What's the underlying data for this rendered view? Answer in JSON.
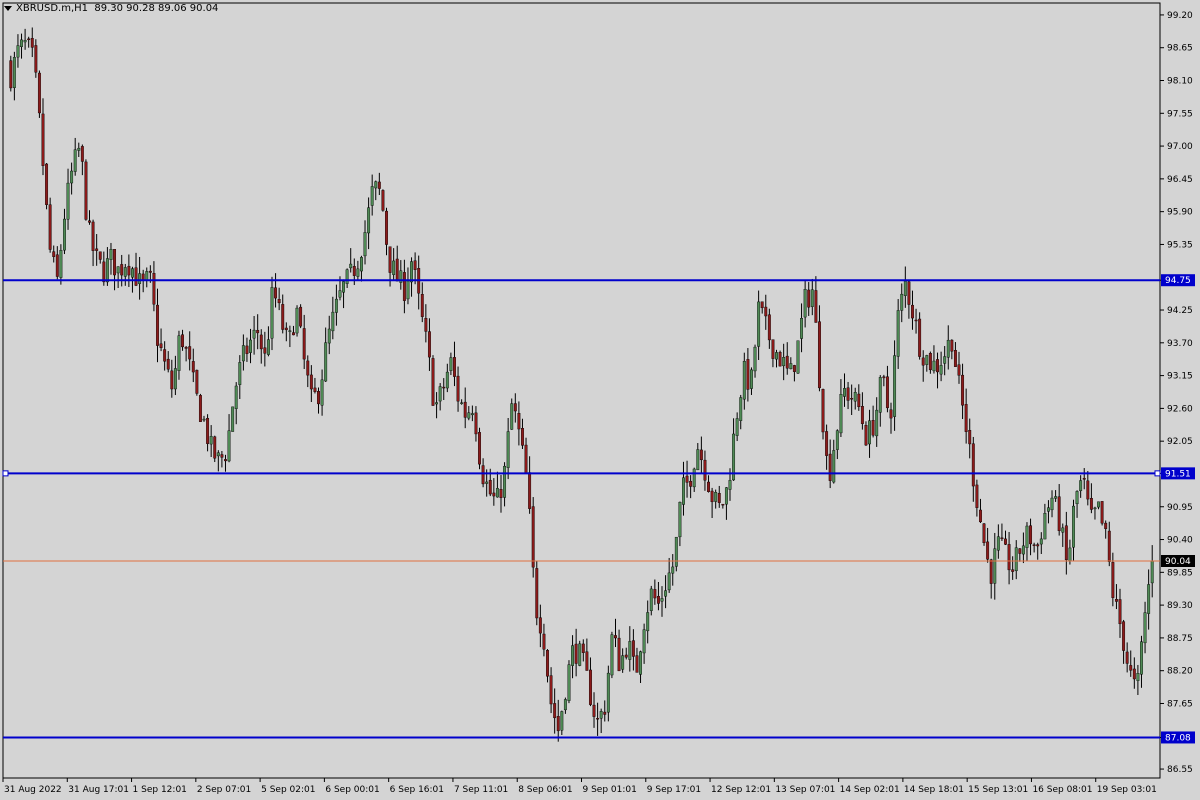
{
  "header": {
    "symbol": "XBRUSD.m,H1",
    "ohlc": "89.30 90.28 89.06 90.04"
  },
  "colors": {
    "background": "#d4d4d4",
    "grid_axis": "#000000",
    "level_line": "#0000cc",
    "bid_line": "#e07040",
    "bull_body": "#4f8a55",
    "bear_body": "#8b1a1a",
    "wick": "#000000"
  },
  "chart_data": {
    "type": "candlestick",
    "grid": false,
    "ylim": [
      86.4,
      99.4
    ],
    "y_ticks": [
      "99.20",
      "98.65",
      "98.10",
      "97.55",
      "97.00",
      "96.45",
      "95.90",
      "95.35",
      "94.75",
      "94.25",
      "93.70",
      "93.15",
      "92.60",
      "92.05",
      "91.51",
      "90.95",
      "90.40",
      "89.85",
      "89.30",
      "88.75",
      "88.20",
      "87.65",
      "87.08",
      "86.55"
    ],
    "x_tick_labels": [
      "31 Aug 2022",
      "31 Aug 17:01",
      "1 Sep 12:01",
      "2 Sep 07:01",
      "5 Sep 02:01",
      "6 Sep 00:01",
      "6 Sep 16:01",
      "7 Sep 11:01",
      "8 Sep 06:01",
      "9 Sep 01:01",
      "9 Sep 17:01",
      "12 Sep 12:01",
      "13 Sep 07:01",
      "14 Sep 02:01",
      "14 Sep 18:01",
      "15 Sep 13:01",
      "16 Sep 08:01",
      "19 Sep 03:01"
    ],
    "level_lines": [
      {
        "value": 94.75,
        "label": "94.75"
      },
      {
        "value": 91.51,
        "label": "91.51"
      },
      {
        "value": 87.08,
        "label": "87.08"
      }
    ],
    "bid_line": {
      "value": 90.04,
      "label": "90.04"
    },
    "close_path": [
      98.2,
      98.6,
      98.7,
      98.4,
      97.0,
      95.3,
      94.7,
      95.9,
      96.6,
      97.0,
      95.6,
      95.1,
      94.9,
      95.1,
      94.9,
      95.1,
      94.9,
      94.6,
      94.8,
      93.8,
      93.3,
      92.9,
      93.9,
      93.4,
      92.8,
      92.4,
      91.9,
      91.7,
      91.9,
      92.9,
      93.4,
      93.7,
      93.9,
      93.4,
      94.6,
      94.1,
      93.6,
      94.3,
      93.4,
      92.7,
      92.9,
      93.7,
      94.2,
      94.6,
      94.8,
      95.1,
      95.6,
      96.3,
      96.2,
      95.1,
      94.8,
      94.6,
      95.1,
      94.3,
      93.6,
      92.6,
      92.9,
      93.4,
      92.8,
      92.5,
      92.7,
      91.6,
      91.2,
      91.0,
      91.5,
      92.7,
      92.1,
      91.3,
      89.3,
      88.9,
      87.7,
      87.2,
      88.0,
      88.6,
      88.4,
      87.9,
      87.3,
      87.6,
      88.8,
      88.3,
      88.7,
      88.1,
      89.0,
      89.5,
      89.3,
      89.7,
      90.0,
      91.2,
      91.4,
      92.0,
      91.6,
      91.1,
      90.9,
      91.3,
      92.4,
      93.2,
      93.0,
      94.3,
      93.9,
      93.6,
      93.4,
      93.1,
      93.6,
      94.4,
      94.6,
      92.9,
      91.4,
      92.2,
      92.9,
      92.8,
      92.6,
      92.1,
      92.4,
      93.1,
      92.4,
      94.1,
      94.7,
      94.2,
      93.6,
      93.4,
      93.3,
      93.5,
      93.8,
      92.9,
      92.2,
      91.3,
      90.5,
      89.8,
      90.3,
      90.1,
      89.9,
      90.3,
      90.5,
      90.2,
      90.8,
      91.1,
      90.7,
      89.9,
      91.1,
      91.4,
      90.7,
      90.9,
      90.4,
      89.4,
      88.9,
      88.2,
      87.8,
      89.1,
      90.04
    ]
  }
}
